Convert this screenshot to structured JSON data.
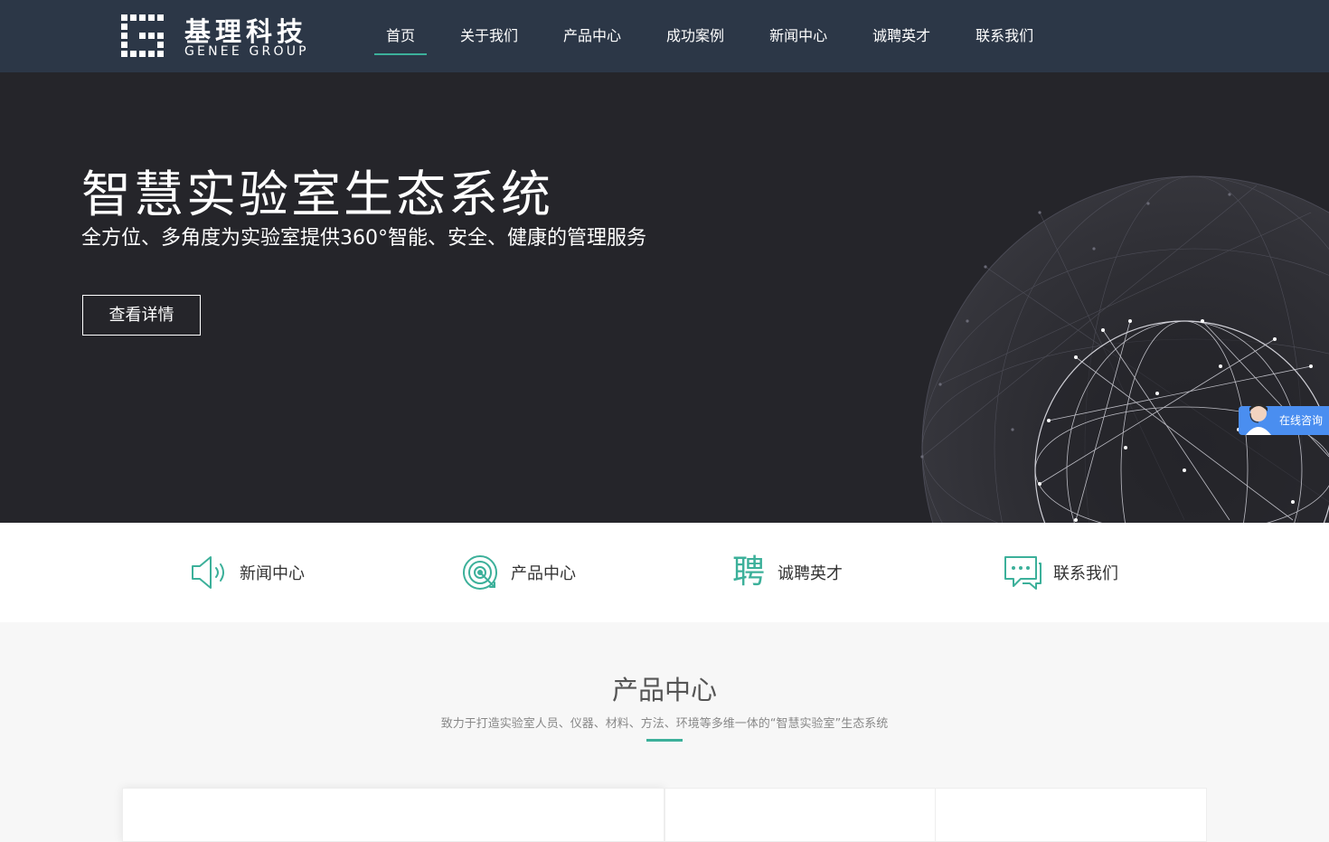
{
  "header": {
    "logo_cn": "基理科技",
    "logo_en": "GENEE GROUP",
    "nav": [
      {
        "label": "首页",
        "active": true
      },
      {
        "label": "关于我们",
        "active": false
      },
      {
        "label": "产品中心",
        "active": false
      },
      {
        "label": "成功案例",
        "active": false
      },
      {
        "label": "新闻中心",
        "active": false
      },
      {
        "label": "诚聘英才",
        "active": false
      },
      {
        "label": "联系我们",
        "active": false
      }
    ]
  },
  "hero": {
    "title": "智慧实验室生态系统",
    "subtitle": "全方位、多角度为实验室提供360°智能、安全、健康的管理服务",
    "button": "查看详情"
  },
  "consult": {
    "label": "在线咨询"
  },
  "quick_links": [
    {
      "icon": "speaker-icon",
      "label": "新闻中心"
    },
    {
      "icon": "target-icon",
      "label": "产品中心"
    },
    {
      "icon": "pin-char-icon",
      "glyph": "聘",
      "label": "诚聘英才"
    },
    {
      "icon": "chat-icon",
      "label": "联系我们"
    }
  ],
  "products": {
    "title": "产品中心",
    "subtitle": "致力于打造实验室人员、仪器、材料、方法、环境等多维一体的“智慧实验室”生态系统"
  },
  "colors": {
    "header_bg": "#2c3747",
    "hero_bg": "#25252a",
    "accent": "#3cb09a",
    "consult_bg": "#4a8ef0"
  }
}
